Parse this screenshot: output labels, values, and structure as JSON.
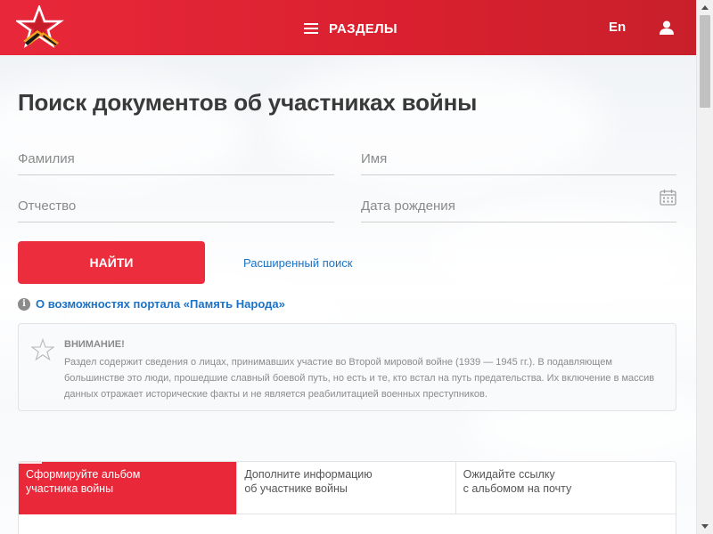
{
  "header": {
    "logo_icon": "red-star-ribbon-logo",
    "menu_label": "РАЗДЕЛЫ",
    "menu_icon": "hamburger-icon",
    "lang_label": "En",
    "user_icon": "user-icon",
    "brand_color": "#e8283a"
  },
  "search": {
    "title": "Поиск документов об участниках войны",
    "surname_placeholder": "Фамилия",
    "name_placeholder": "Имя",
    "patronymic_placeholder": "Отчество",
    "birthdate_placeholder": "Дата рождения",
    "find_label": "НАЙТИ",
    "advanced_label": "Расширенный поиск",
    "about_label": "О возможностях портала «Память Народа»",
    "info_glyph": "i"
  },
  "warning": {
    "icon": "star-outline-icon",
    "title": "ВНИМАНИЕ!",
    "text": "Раздел содержит сведения о лицах, принимавших участие во Второй мировой войне (1939 — 1945 гг.). В подавляющем большинстве это люди, прошедшие славный боевой путь, но есть и те, кто встал на путь предательства. Их включение в массив данных отражает исторические факты и не является реабилитацией военных преступников."
  },
  "steps": [
    {
      "line1": "Сформируйте альбом",
      "line2": "участника войны",
      "active": true
    },
    {
      "line1": "Дополните информацию",
      "line2": "об участнике войны",
      "active": false
    },
    {
      "line1": "Ожидайте ссылку",
      "line2": "с альбомом на почту",
      "active": false
    }
  ],
  "colors": {
    "accent": "#eb2d3e",
    "link": "#1a73c9"
  }
}
